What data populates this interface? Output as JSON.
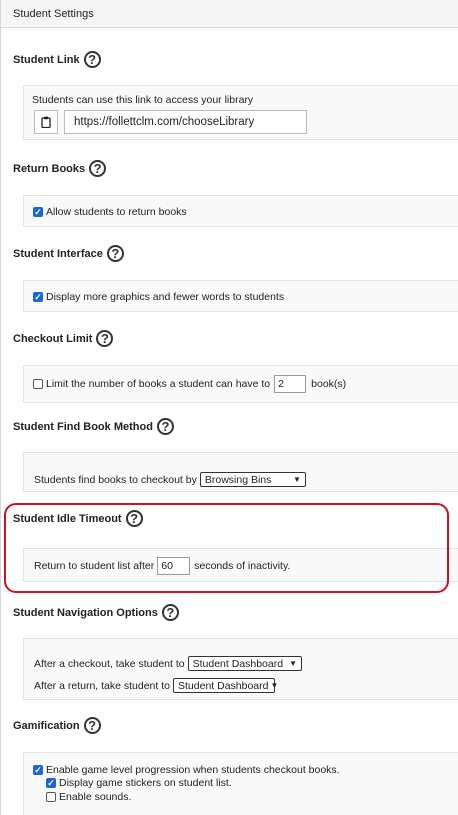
{
  "header": {
    "title": "Student Settings"
  },
  "student_link": {
    "title": "Student Link",
    "description": "Students can use this link to access your library",
    "url": "https://follettclm.com/chooseLibrary"
  },
  "return_books": {
    "title": "Return Books",
    "checkbox_label": "Allow students to return books",
    "checked": true
  },
  "student_interface": {
    "title": "Student Interface",
    "checkbox_label": "Display more graphics and fewer words to students",
    "checked": true
  },
  "checkout_limit": {
    "title": "Checkout Limit",
    "checkbox_label": "Limit the number of books a student can have to",
    "value": "2",
    "suffix": "book(s)",
    "checked": false
  },
  "find_book_method": {
    "title": "Student Find Book Method",
    "label": "Students find books to checkout by",
    "selected": "Browsing Bins"
  },
  "idle_timeout": {
    "title": "Student Idle Timeout",
    "prefix": "Return to student list after",
    "value": "60",
    "suffix": "seconds of inactivity.",
    "highlight_color": "#d0101e"
  },
  "navigation_options": {
    "title": "Student Navigation Options",
    "after_checkout_label": "After a checkout, take student to",
    "after_checkout_selected": "Student Dashboard",
    "after_return_label": "After a return, take student to",
    "after_return_selected": "Student Dashboard"
  },
  "gamification": {
    "title": "Gamification",
    "enable_progression_label": "Enable game level progression when students checkout books.",
    "enable_progression_checked": true,
    "display_stickers_label": "Display game stickers on student list.",
    "display_stickers_checked": true,
    "enable_sounds_label": "Enable sounds.",
    "enable_sounds_checked": false
  },
  "help_symbol": "?",
  "accent_color": "#1a66d6"
}
